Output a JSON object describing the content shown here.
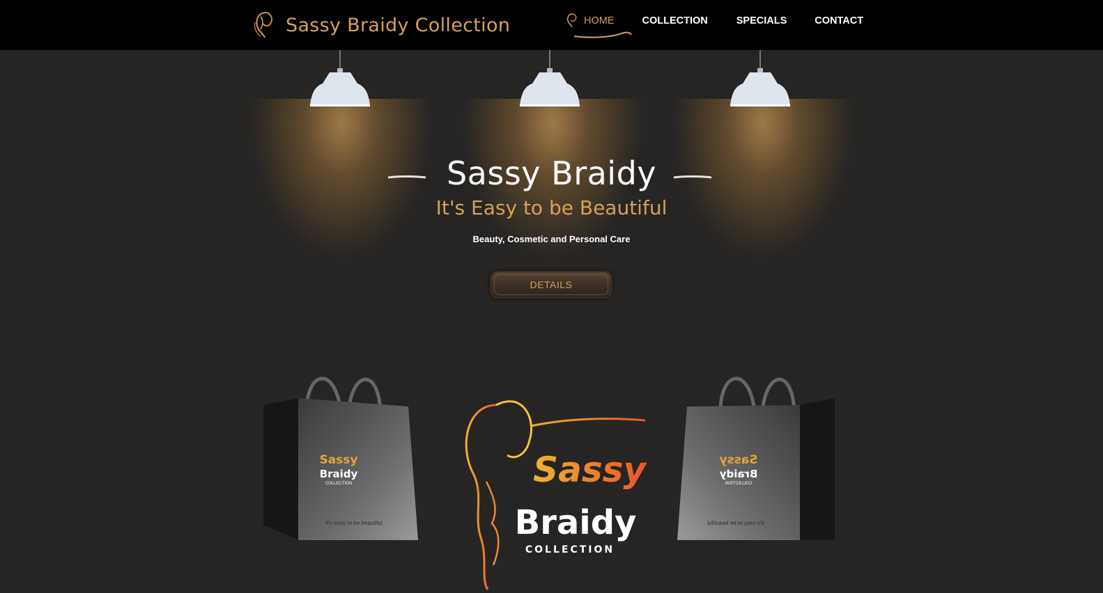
{
  "brand": {
    "name": "Sassy Braidy Collection",
    "icon": "braid-woman-icon"
  },
  "nav": {
    "items": [
      {
        "label": "HOME",
        "active": true
      },
      {
        "label": "COLLECTION"
      },
      {
        "label": "SPECIALS"
      },
      {
        "label": "CONTACT"
      }
    ]
  },
  "hero": {
    "title": "Sassy Braidy",
    "subtitle": "It's Easy to be Beautiful",
    "tagline": "Beauty, Cosmetic and Personal Care",
    "button": "DETAILS"
  },
  "bag": {
    "logo_top": "Sassy",
    "logo_bottom": "Braidy",
    "logo_small": "COLLECTION",
    "slogan": "It's easy to be beautiful"
  },
  "logo": {
    "top": "Sassy",
    "middle": "Braidy",
    "bottom": "COLLECTION"
  },
  "colors": {
    "accent": "#d4a257",
    "background": "#262524",
    "topbar": "#000000"
  }
}
